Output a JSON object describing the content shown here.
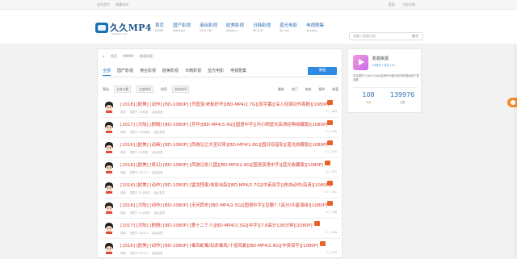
{
  "topbar": {
    "left": [
      "设为首页",
      "收藏本站"
    ],
    "right": [
      "登录",
      "立即注册"
    ]
  },
  "logo": {
    "name": "久久MP4",
    "sub": "99mp4.com"
  },
  "nav": [
    {
      "t": "首页",
      "e": "HOME"
    },
    {
      "t": "国产影视",
      "e": "Mainland"
    },
    {
      "t": "港台影视",
      "e": "HK & TW"
    },
    {
      "t": "欧美影视",
      "e": "Western"
    },
    {
      "t": "日韩影视",
      "e": "KR & JP"
    },
    {
      "t": "蓝光电影",
      "e": "Blu-ray"
    },
    {
      "t": "电视剧集",
      "e": "Teleplay"
    }
  ],
  "search": {
    "placeholder": "请输入搜索内容",
    "button": "帖子"
  },
  "breadcrumb": [
    "⌂",
    "首页",
    "99MP4",
    "影视资源"
  ],
  "tabs": [
    "全部",
    "国产影视",
    "港台影视",
    "欧美影视",
    "日韩影视",
    "蓝光电影",
    "电视剧集"
  ],
  "post_button": "发帖",
  "filters": {
    "label1": "筛选:",
    "sel1": "全部主题",
    "sel2": "全部时间",
    "label2": "排序:",
    "sel3": "发帖时间",
    "right": [
      "最新",
      "热门",
      "热帖",
      "精华",
      "新窗"
    ]
  },
  "rows": [
    {
      "title": "[2018] [欧美] [动作] [BD-1080P] [齐国宝/老板好坏][BD-MP4/2.7G][双字幕][深入佳境动作喜剧][1080P]",
      "user": "风雨",
      "date": "发表于 2小时前",
      "last": "最后发表",
      "stats": "0  □ 284"
    },
    {
      "title": "[2017] [大陆] [剧情] [BD-1080P] [芳华][BD-MP4/3.4G][国语中字][冯小刚蓝光高清经典收藏版][1080P]",
      "user": "风雨",
      "date": "发表于 15分钟前",
      "last": "最后发表",
      "stats": "0  □ 230"
    },
    {
      "title": "[2016] [欧美] [动画] [BD-1080P] [西游记之大圣归来][BD-MP4/1.8G][国日双音轨][蓝光收藏版][1080P]",
      "user": "风雨",
      "date": "发表于 2小时前",
      "last": "最后发表",
      "stats": "0  □ 142"
    },
    {
      "title": "[2018] [欧美] [奇幻] [BD-1080P] [西游记女儿国][BD-MP4/2.9G][国语双语中字][蓝光收藏版][1080P]",
      "user": "风雨",
      "date": "发表于 2017-1",
      "last": "最后发表",
      "stats": "0  □ 297"
    },
    {
      "title": "[2018] [欧美] [动作] [BD-1080P] [猛龙怪客/侠影仙踪][BD-MP4/2.7G][中英双字][热血动作/高清][1080P]",
      "user": "风雨",
      "date": "发表于 11小时前",
      "last": "最后发表",
      "stats": "0  □ 311"
    },
    {
      "title": "[2018] [大陆] [动作] [BD-1080P] [无问西东][BD-MP4/2.5G][国语中字][豆瓣7.7高分/众星演绎][1080P]",
      "user": "风雨",
      "date": "发表于 14小时前",
      "last": "最后发表",
      "stats": "0  □ 256"
    },
    {
      "title": "[2017] [大陆] [剧情] [BD-1080P] [第十二个人][BD-MP4/3.3G][中字][7.8高分136分钟][1080P]",
      "user": "风雨",
      "date": "发表于 2018-1",
      "last": "最后发表",
      "stats": "0  □ 284"
    },
    {
      "title": "[2016] [欧美] [动作] [BD-1080P] [毒凤蛇毒/玩命毒风/十倍风暴][BD-MP4/2.6G][中英双字][1080P]",
      "user": "风雨",
      "date": "发表于 2018-1",
      "last": "最后发表",
      "stats": "0  □ 234"
    }
  ],
  "side": {
    "name": "影视资源",
    "info": "24帖子 / 今日 122",
    "desc": "本站提供720p/1080p高清MP4格式影视资源免费下载观看",
    "n1": "108",
    "l1": "今日",
    "n2": "139976",
    "l2": "主题"
  },
  "colors": {
    "accent": "#2d8ae0",
    "title_red": "#d9382a",
    "badge": "#e8622b"
  }
}
